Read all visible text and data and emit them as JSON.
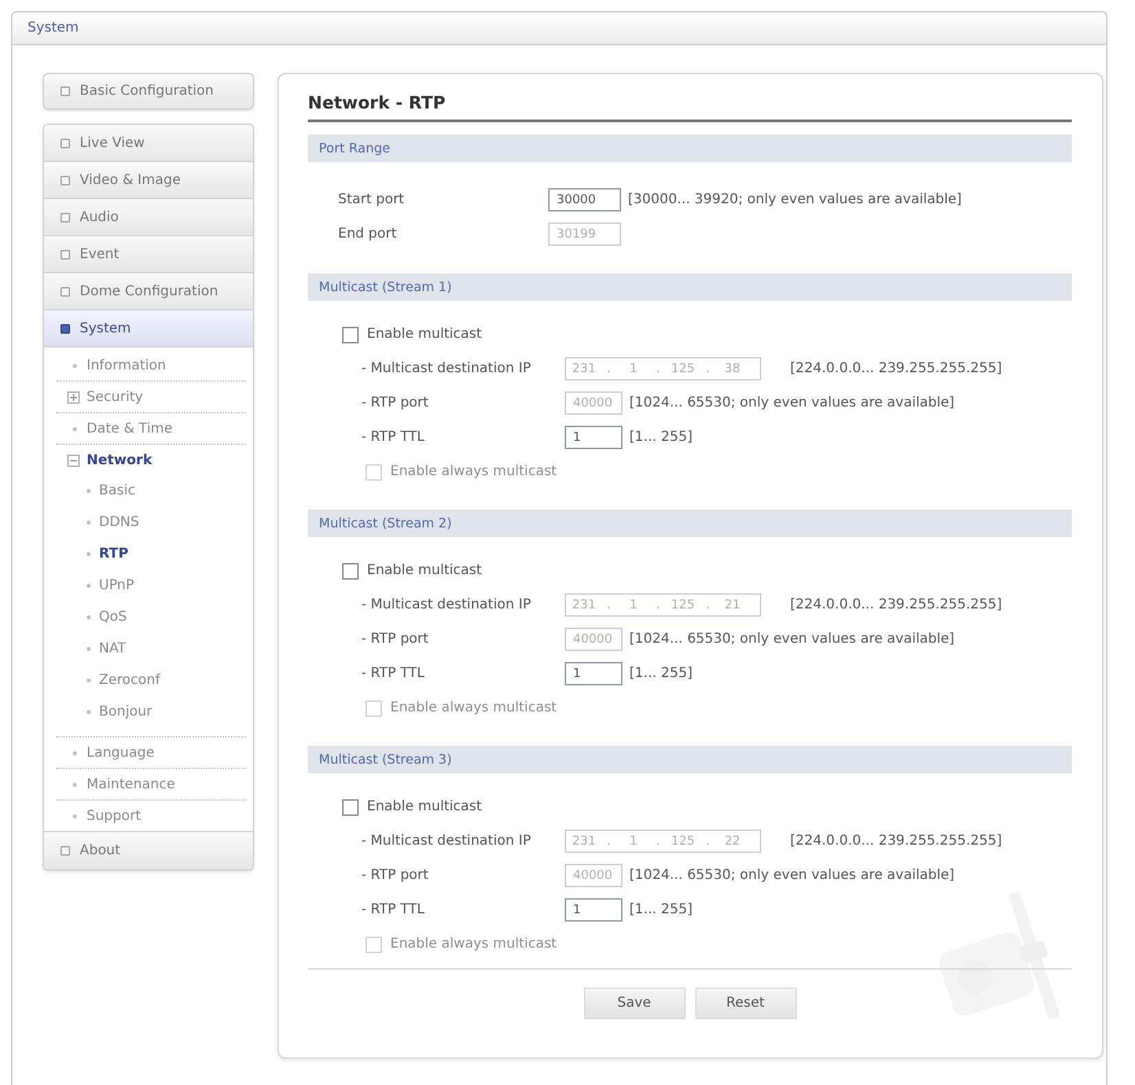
{
  "header": {
    "title": "System"
  },
  "sidebar": {
    "basic_configuration": {
      "label": "Basic Configuration"
    },
    "menu": [
      {
        "label": "Live View",
        "selected": false
      },
      {
        "label": "Video & Image",
        "selected": false
      },
      {
        "label": "Audio",
        "selected": false
      },
      {
        "label": "Event",
        "selected": false
      },
      {
        "label": "Dome Configuration",
        "selected": false
      },
      {
        "label": "System",
        "selected": true,
        "children": [
          {
            "kind": "page",
            "label": "Information",
            "selected": false
          },
          {
            "kind": "folder",
            "label": "Security",
            "selected": false,
            "expanded": false
          },
          {
            "kind": "page",
            "label": "Date & Time",
            "selected": false
          },
          {
            "kind": "folder",
            "label": "Network",
            "selected": true,
            "expanded": true,
            "children": [
              {
                "label": "Basic",
                "selected": false
              },
              {
                "label": "DDNS",
                "selected": false
              },
              {
                "label": "RTP",
                "selected": true
              },
              {
                "label": "UPnP",
                "selected": false
              },
              {
                "label": "QoS",
                "selected": false
              },
              {
                "label": "NAT",
                "selected": false
              },
              {
                "label": "Zeroconf",
                "selected": false
              },
              {
                "label": "Bonjour",
                "selected": false
              }
            ]
          },
          {
            "kind": "page",
            "label": "Language",
            "selected": false
          },
          {
            "kind": "page",
            "label": "Maintenance",
            "selected": false
          },
          {
            "kind": "page",
            "label": "Support",
            "selected": false
          }
        ]
      },
      {
        "label": "About",
        "selected": false
      }
    ]
  },
  "panel": {
    "title": "Network - RTP",
    "sections": [
      {
        "kind": "ports",
        "title": "Port Range",
        "rows": [
          {
            "kind": "number",
            "label": "Start port",
            "value": "30000",
            "disabled": false,
            "hint": "[30000... 39920; only even values are available]"
          },
          {
            "kind": "number",
            "label": "End port",
            "value": "30199",
            "disabled": true
          }
        ]
      },
      {
        "kind": "multicast",
        "title": "Multicast (Stream 1)",
        "enable": {
          "label": "Enable multicast",
          "checked": false
        },
        "rows": [
          {
            "kind": "ip",
            "label": "- Multicast destination IP",
            "octets": [
              "231",
              "1",
              "125",
              "38"
            ],
            "separator": ".",
            "disabled": true,
            "hint": "[224.0.0.0... 239.255.255.255]"
          },
          {
            "kind": "number",
            "label": "- RTP port",
            "value": "40000",
            "disabled": true,
            "hint": "[1024... 65530; only even values are available]"
          },
          {
            "kind": "number",
            "label": "- RTP TTL",
            "value": "1",
            "disabled": false,
            "hint": "[1... 255]"
          }
        ],
        "always": {
          "label": "Enable always multicast",
          "checked": false,
          "disabled": true
        }
      },
      {
        "kind": "multicast",
        "title": "Multicast (Stream 2)",
        "enable": {
          "label": "Enable multicast",
          "checked": false
        },
        "rows": [
          {
            "kind": "ip",
            "label": "- Multicast destination IP",
            "octets": [
              "231",
              "1",
              "125",
              "21"
            ],
            "separator": ".",
            "disabled": true,
            "hint": "[224.0.0.0... 239.255.255.255]"
          },
          {
            "kind": "number",
            "label": "- RTP port",
            "value": "40000",
            "disabled": true,
            "hint": "[1024... 65530; only even values are available]"
          },
          {
            "kind": "number",
            "label": "- RTP TTL",
            "value": "1",
            "disabled": false,
            "hint": "[1... 255]"
          }
        ],
        "always": {
          "label": "Enable always multicast",
          "checked": false,
          "disabled": true
        }
      },
      {
        "kind": "multicast",
        "title": "Multicast (Stream 3)",
        "enable": {
          "label": "Enable multicast",
          "checked": false
        },
        "rows": [
          {
            "kind": "ip",
            "label": "- Multicast destination IP",
            "octets": [
              "231",
              "1",
              "125",
              "22"
            ],
            "separator": ".",
            "disabled": true,
            "hint": "[224.0.0.0... 239.255.255.255]"
          },
          {
            "kind": "number",
            "label": "- RTP port",
            "value": "40000",
            "disabled": true,
            "hint": "[1024... 65530; only even values are available]"
          },
          {
            "kind": "number",
            "label": "- RTP TTL",
            "value": "1",
            "disabled": false,
            "hint": "[1... 255]"
          }
        ],
        "always": {
          "label": "Enable always multicast",
          "checked": false,
          "disabled": true
        }
      }
    ],
    "buttons": [
      {
        "label": "Save"
      },
      {
        "label": "Reset"
      }
    ]
  }
}
